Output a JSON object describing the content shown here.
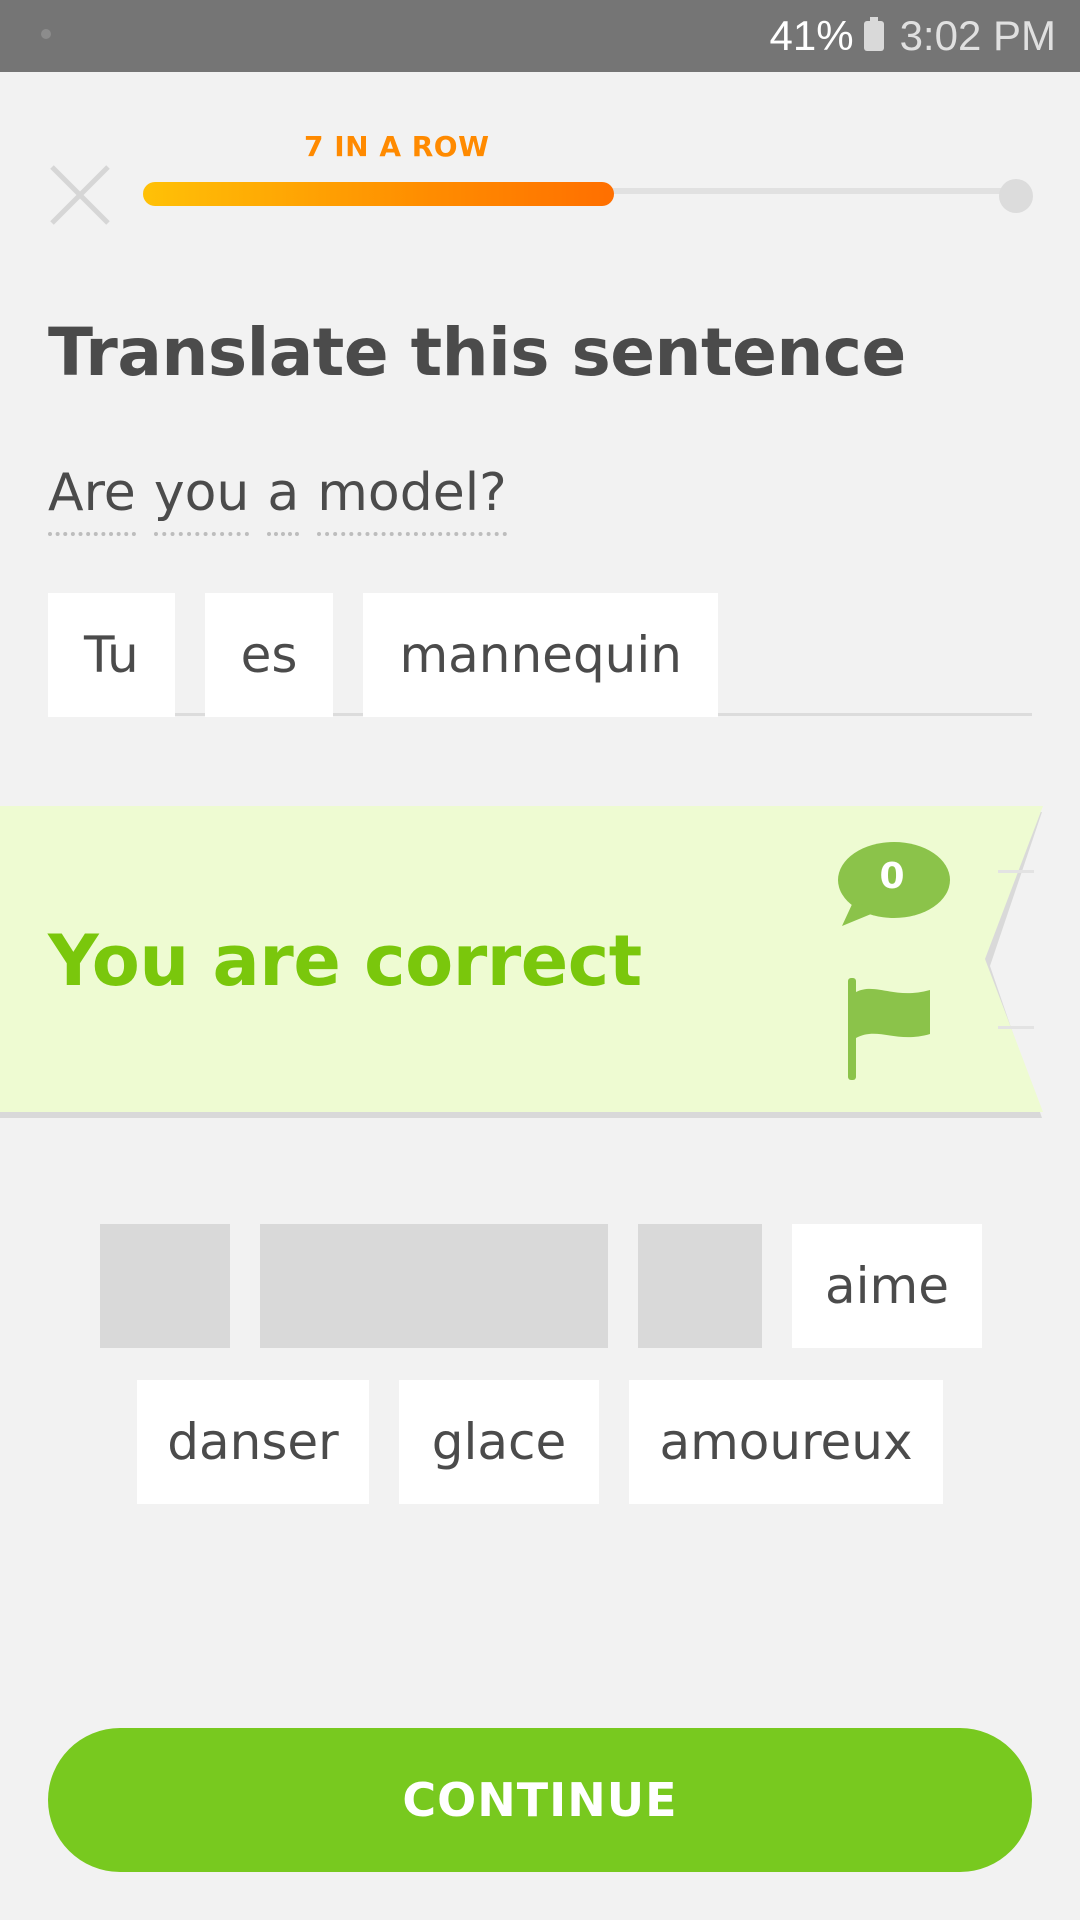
{
  "status_bar": {
    "battery_percent": "41%",
    "time": "3:02 PM",
    "icons": [
      "notification-dot-icon",
      "battery-icon"
    ]
  },
  "header": {
    "streak_label": "7 IN A ROW",
    "progress": 0.54,
    "progress_colors": [
      "#ffc107",
      "#ff6f00"
    ],
    "close_icon": "close-icon"
  },
  "prompt": {
    "title": "Translate this sentence",
    "source_words": [
      "Are",
      "you",
      "a",
      "model?"
    ]
  },
  "answer": {
    "tiles": [
      "Tu",
      "es",
      "mannequin"
    ]
  },
  "feedback": {
    "message": "You are correct",
    "comment_count": "0",
    "icons": [
      "comment-bubble-icon",
      "flag-icon"
    ],
    "accent_color": "#7ac70c",
    "background_color": "#eefbd2"
  },
  "word_bank": {
    "row1": [
      {
        "label": "",
        "used": true
      },
      {
        "label": "",
        "used": true
      },
      {
        "label": "",
        "used": true
      },
      {
        "label": "aime",
        "used": false
      }
    ],
    "row2": [
      {
        "label": "danser",
        "used": false
      },
      {
        "label": "glace",
        "used": false
      },
      {
        "label": "amoureux",
        "used": false
      }
    ]
  },
  "continue": {
    "label": "CONTINUE",
    "color": "#78c91f"
  }
}
